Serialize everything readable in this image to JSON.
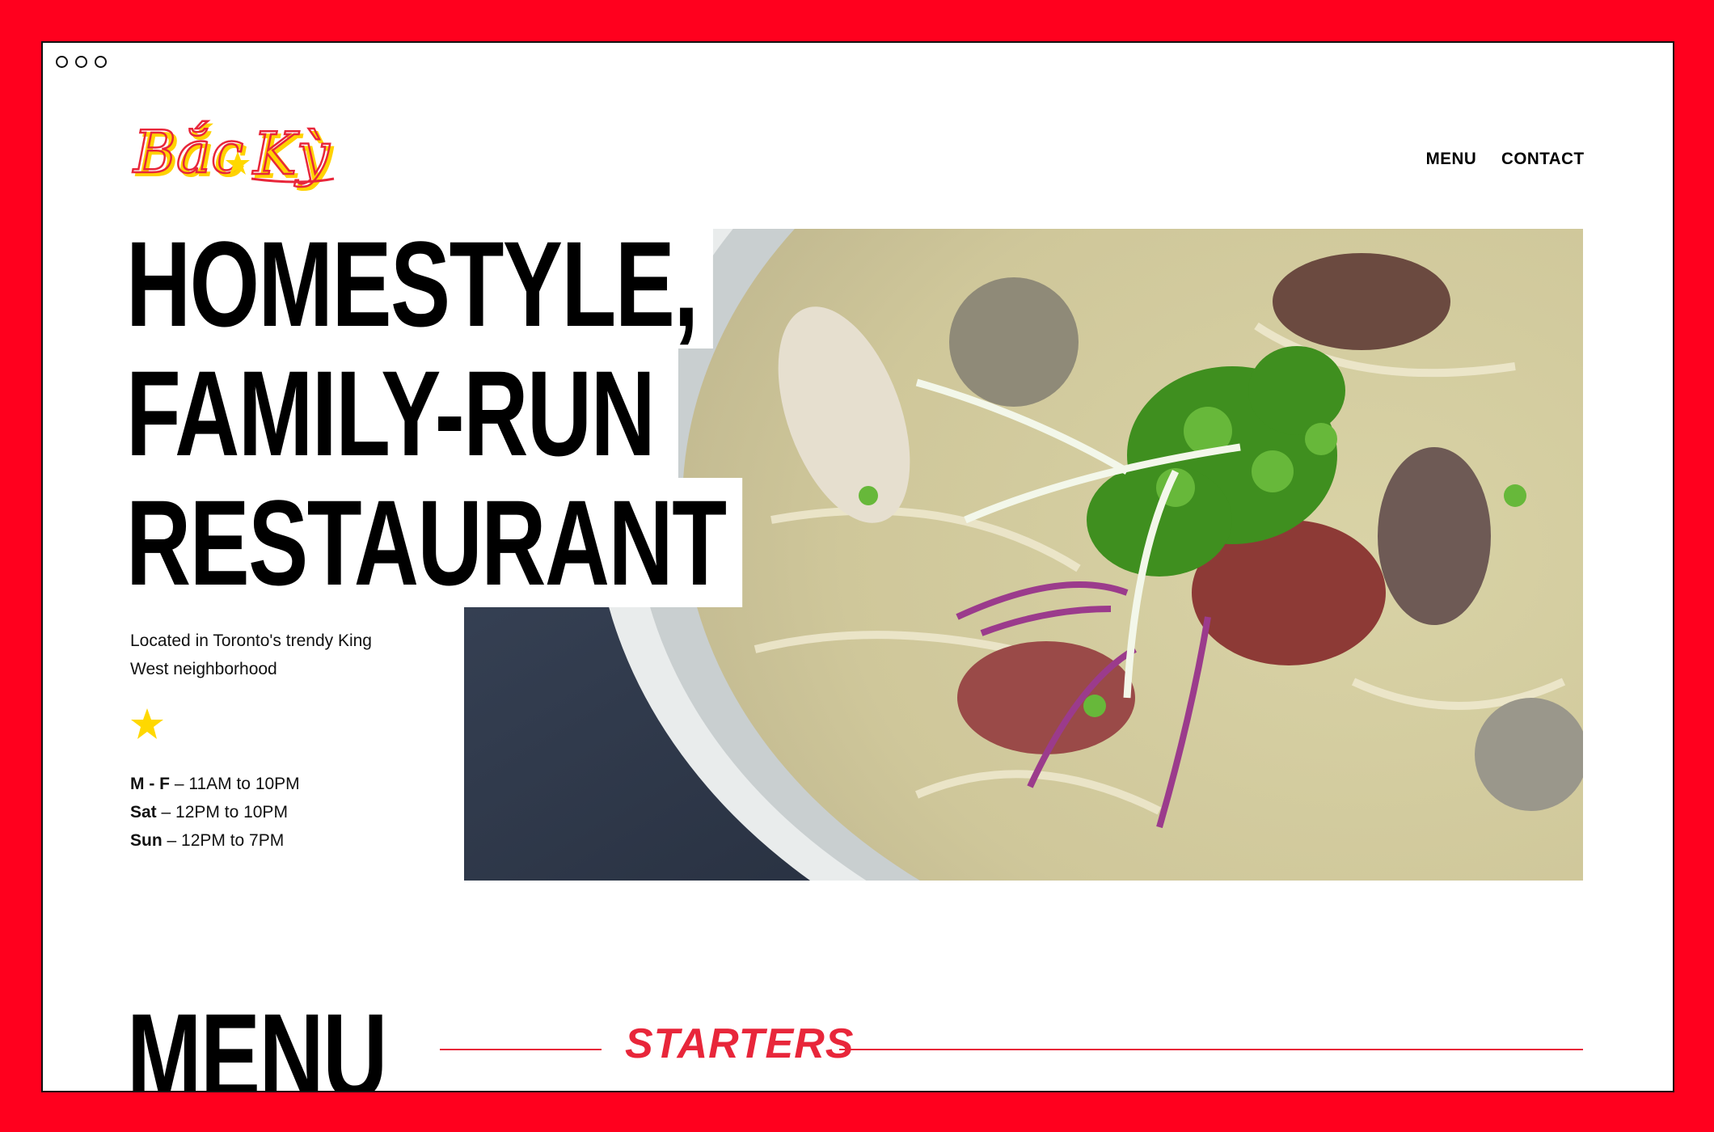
{
  "logo": {
    "text": "Bắc Kỳ"
  },
  "nav": {
    "menu": "MENU",
    "contact": "CONTACT"
  },
  "hero": {
    "title_lines": [
      "HOMESTYLE,",
      "FAMILY-RUN",
      "RESTAURANT"
    ],
    "location": "Located in Toronto's trendy King West neighborhood",
    "image": "pho-bowl-photo"
  },
  "hours": [
    {
      "days": "M - F",
      "time": " – 11AM to 10PM"
    },
    {
      "days": "Sat",
      "time": " – 12PM to 10PM"
    },
    {
      "days": "Sun",
      "time": " – 12PM to 7PM"
    }
  ],
  "menu": {
    "title": "MENU",
    "section": "STARTERS"
  },
  "colors": {
    "brand_red": "#ff001e",
    "accent_red": "#e8263a",
    "star_yellow": "#ffd800"
  }
}
